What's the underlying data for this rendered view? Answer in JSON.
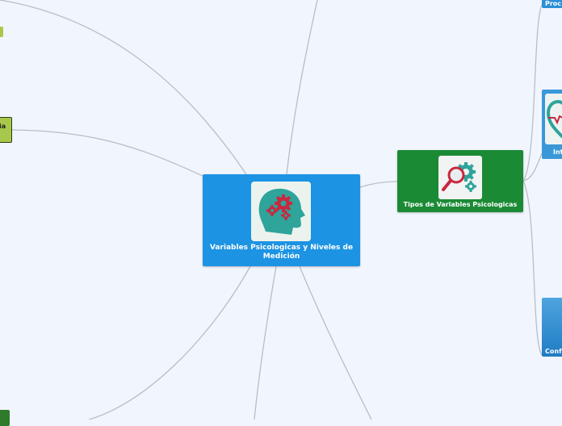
{
  "central": {
    "label": "Variables Psicologicas y Niveles de Medición"
  },
  "tipos": {
    "label": "Tipos de Variables Psicologicas"
  },
  "right_nodes": {
    "procesos": "Proc",
    "intervinientes": "Int",
    "confusoras": "Conf"
  },
  "left_nodes": {
    "middle_label": "ia"
  },
  "colors": {
    "background": "#f1f5fd",
    "central": "#1c93e3",
    "tipos": "#1b8a35",
    "right_nodes": "#2b8fd6",
    "left_green": "#a7c84a",
    "connector": "#b9bec6"
  },
  "icons": {
    "central": "head-gears-icon",
    "tipos": "magnifier-gears-icon",
    "intervinientes": "heart-pulse-icon"
  }
}
